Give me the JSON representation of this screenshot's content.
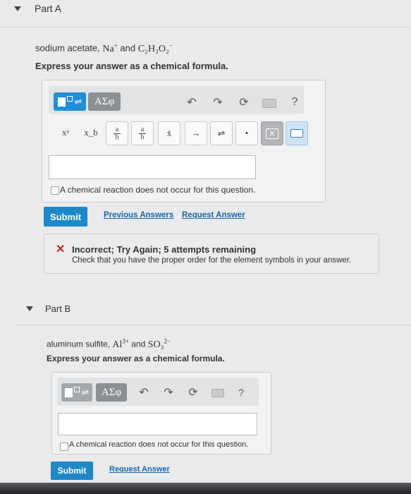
{
  "partA": {
    "title": "Part A",
    "prompt_text": "sodium acetate, ",
    "prompt_formula1_base": "Na",
    "prompt_formula1_sup": "+",
    "prompt_and": " and ",
    "prompt_formula2": "C₂H₃O₂",
    "prompt_formula2_sup": "−",
    "instruction": "Express your answer as a chemical formula.",
    "toolbar": {
      "greek_label": "ΑΣφ",
      "help_label": "?",
      "keys": [
        "xᵃ",
        "x_b",
        "a/b",
        "a/b",
        "x̄",
        "→",
        "⇌",
        "•"
      ]
    },
    "answer_value": "",
    "no_reaction_label": "A chemical reaction does not occur for this question.",
    "submit_label": "Submit",
    "previous_answers_label": "Previous Answers",
    "request_answer_label": "Request Answer",
    "feedback": {
      "title": "Incorrect; Try Again; 5 attempts remaining",
      "detail": "Check that you have the proper order for the element symbols in your answer."
    }
  },
  "partB": {
    "title": "Part B",
    "prompt_text": "aluminum sulfite, ",
    "prompt_formula1_base": "Al",
    "prompt_formula1_sup": "3+",
    "prompt_and": " and ",
    "prompt_formula2": "SO₃",
    "prompt_formula2_sup": "2−",
    "instruction": "Express your answer as a chemical formula.",
    "toolbar": {
      "greek_label": "ΑΣφ",
      "help_label": "?"
    },
    "answer_value": "",
    "no_reaction_label": "A chemical reaction does not occur for this question.",
    "submit_label": "Submit",
    "request_answer_label": "Request Answer"
  },
  "colors": {
    "accent_blue": "#1f88c7",
    "error_red": "#cc2a2a",
    "link_blue": "#1a66a8"
  }
}
